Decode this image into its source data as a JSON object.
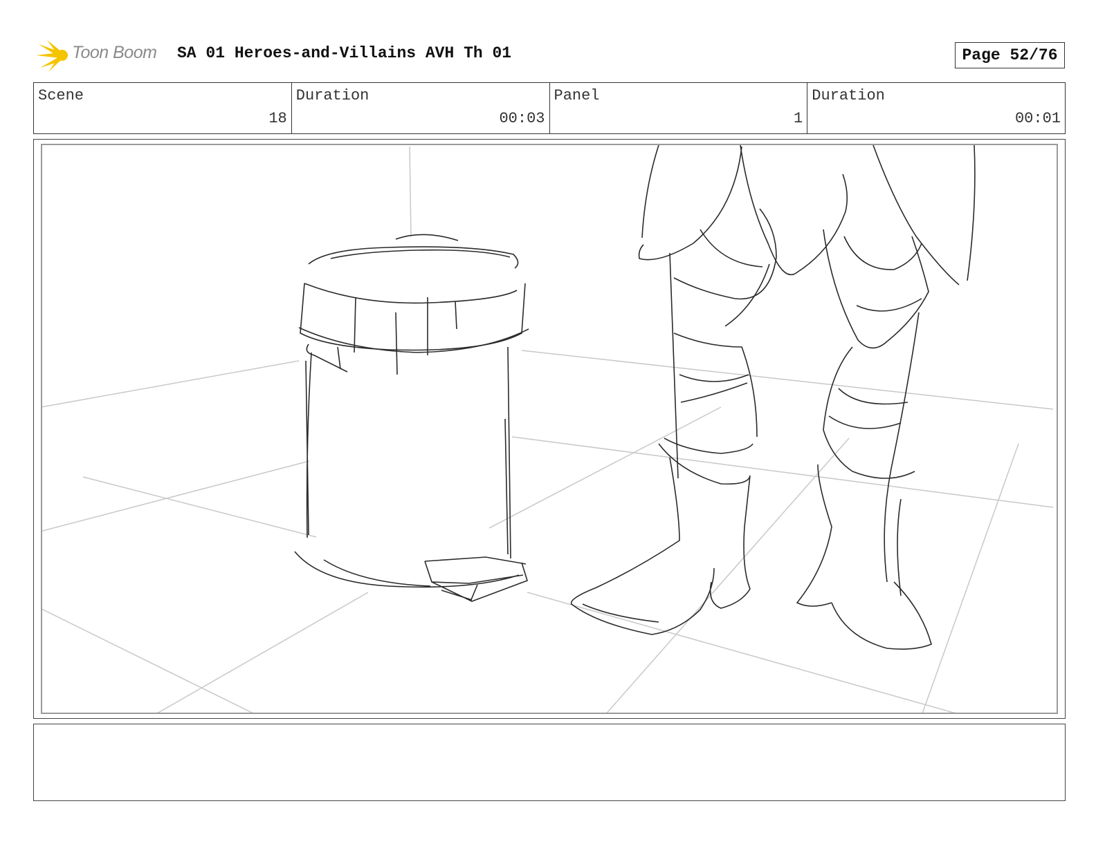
{
  "header": {
    "logo_text": "Toon Boom",
    "title": "SA 01 Heroes-and-Villains AVH Th 01",
    "page_label": "Page 52/76"
  },
  "info": {
    "scene_label": "Scene",
    "scene_value": "18",
    "scene_duration_label": "Duration",
    "scene_duration_value": "00:03",
    "panel_label": "Panel",
    "panel_value": "1",
    "panel_duration_label": "Duration",
    "panel_duration_value": "00:01"
  },
  "colors": {
    "logo_yellow": "#f5c400",
    "logo_gray": "#8a8a8a",
    "sketch_line": "#2a2a2a",
    "guide_line": "#c8c8c8"
  },
  "notes": {
    "text": ""
  }
}
